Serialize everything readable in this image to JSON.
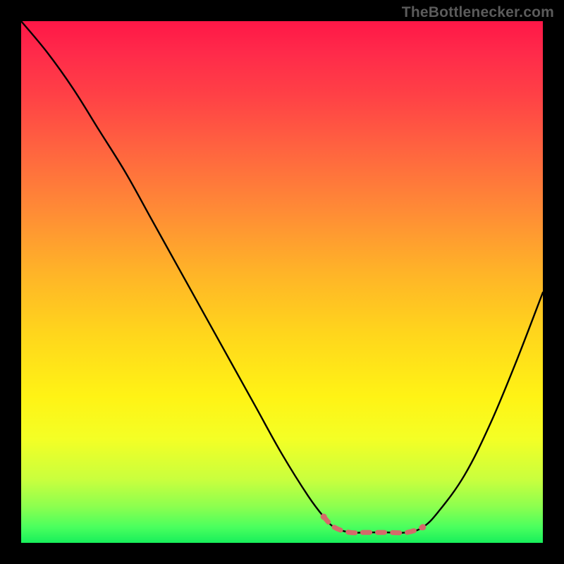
{
  "watermark": "TheBottleneсker.com",
  "colors": {
    "background": "#000000",
    "gradient_top": "#ff1747",
    "gradient_bottom": "#17ef5b",
    "curve": "#000000",
    "highlight": "#d46a6a"
  },
  "chart_data": {
    "type": "line",
    "title": "",
    "xlabel": "",
    "ylabel": "",
    "xlim": [
      0,
      100
    ],
    "ylim": [
      0,
      100
    ],
    "grid": false,
    "legend": false,
    "note": "y is percentage height from bottom; curve drops from ~100 at left, reaches ~2 around x≈60–75, rises to ~48 at right edge",
    "series": [
      {
        "name": "bottleneck-curve",
        "x": [
          0,
          5,
          10,
          15,
          20,
          25,
          30,
          35,
          40,
          45,
          50,
          55,
          58,
          60,
          63,
          66,
          70,
          74,
          77,
          80,
          85,
          90,
          95,
          100
        ],
        "y": [
          100,
          94,
          87,
          79,
          71,
          62,
          53,
          44,
          35,
          26,
          17,
          9,
          5,
          3,
          2,
          2,
          2,
          2,
          3,
          6,
          13,
          23,
          35,
          48
        ]
      }
    ],
    "highlight_segment": {
      "name": "flat-minimum",
      "x": [
        58,
        60,
        63,
        66,
        70,
        74,
        77
      ],
      "y": [
        5,
        3,
        2,
        2,
        2,
        2,
        3
      ]
    }
  }
}
